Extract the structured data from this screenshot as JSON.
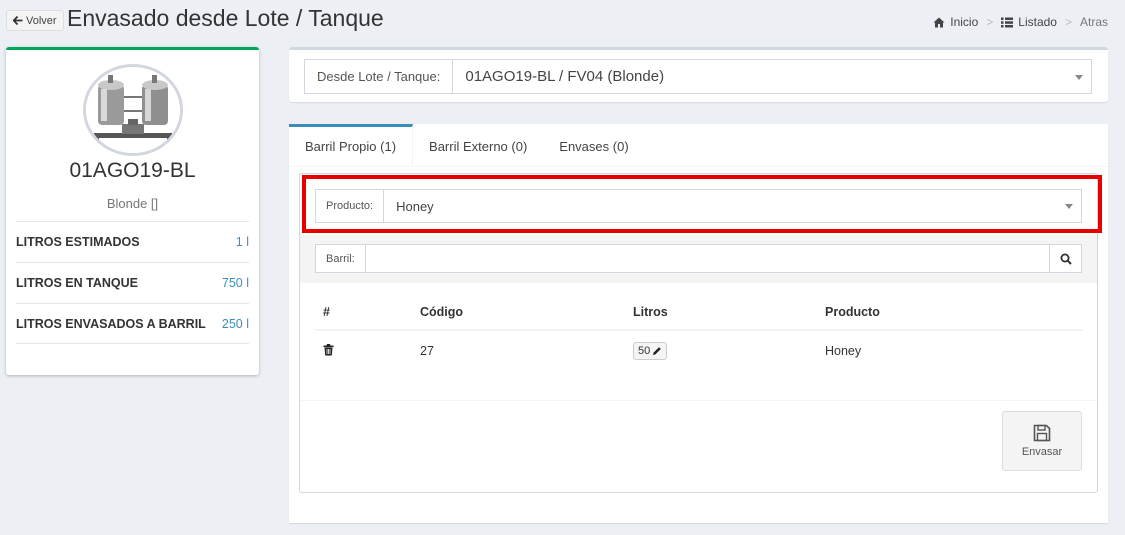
{
  "header": {
    "back_label": "Volver",
    "title": "Envasado desde Lote / Tanque",
    "breadcrumb": [
      "Inicio",
      "Listado",
      "Atras"
    ]
  },
  "profile": {
    "lot": "01AGO19-BL",
    "subtitle": "Blonde []",
    "stats": [
      {
        "label": "LITROS ESTIMADOS",
        "value": "1 l"
      },
      {
        "label": "LITROS EN TANQUE",
        "value": "750 l"
      },
      {
        "label": "LITROS ENVASADOS A BARRIL",
        "value": "250 l"
      }
    ]
  },
  "lote_select": {
    "label": "Desde Lote / Tanque:",
    "value": "01AGO19-BL / FV04 (Blonde)"
  },
  "tabs": [
    {
      "label": "Barril Propio (1)",
      "active": true
    },
    {
      "label": "Barril Externo (0)",
      "active": false
    },
    {
      "label": "Envases (0)",
      "active": false
    }
  ],
  "producto": {
    "label": "Producto:",
    "value": "Honey"
  },
  "barril": {
    "label": "Barril:",
    "value": ""
  },
  "table": {
    "headers": [
      "#",
      "Código",
      "Litros",
      "Producto"
    ],
    "rows": [
      {
        "codigo": "27",
        "litros": "50",
        "producto": "Honey"
      }
    ]
  },
  "actions": {
    "envasar_label": "Envasar"
  },
  "colors": {
    "accent": "#3c8dbc",
    "success": "#00a65a",
    "highlight": "#e60000"
  }
}
